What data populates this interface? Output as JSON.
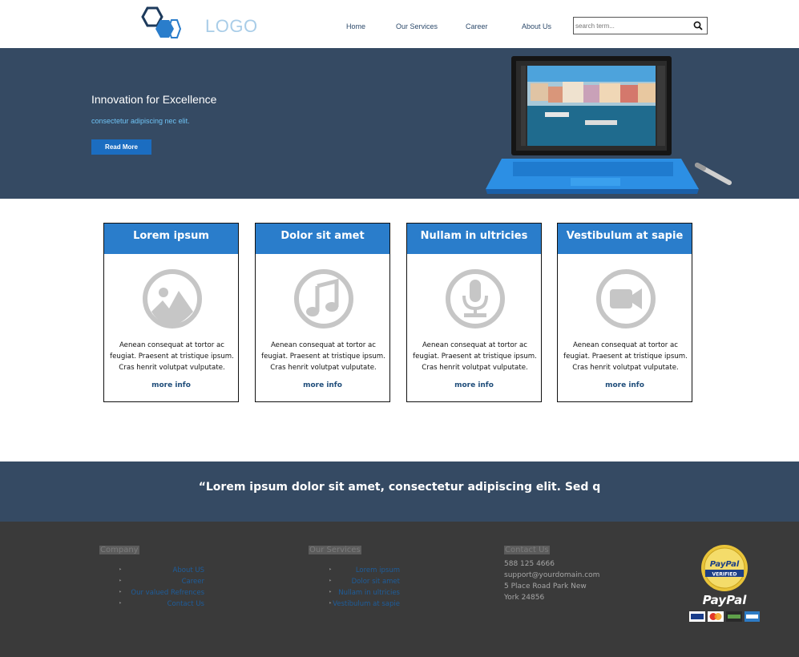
{
  "header": {
    "logo_text": "LOGO",
    "nav": [
      "Home",
      "Our Services",
      "Career",
      "About Us"
    ],
    "search_placeholder": "search term..."
  },
  "hero": {
    "title": "Innovation for Excellence",
    "subtitle": "consectetur adipiscing nec elit.",
    "button_label": "Read More"
  },
  "cards": [
    {
      "title": "Lorem ipsum",
      "icon": "image-icon",
      "text": "Aenean consequat at tortor ac feugiat. Praesent at tristique ipsum. Cras henrit volutpat vulputate.",
      "link": "more info"
    },
    {
      "title": "Dolor sit amet",
      "icon": "music-icon",
      "text": "Aenean consequat at tortor ac feugiat. Praesent at tristique ipsum. Cras henrit volutpat vulputate.",
      "link": "more info"
    },
    {
      "title": "Nullam in ultricies",
      "icon": "microphone-icon",
      "text": "Aenean consequat at tortor ac feugiat. Praesent at tristique ipsum. Cras henrit volutpat vulputate.",
      "link": "more info"
    },
    {
      "title": "Vestibulum at sapie",
      "icon": "video-camera-icon",
      "text": "Aenean consequat at tortor ac feugiat. Praesent at tristique ipsum. Cras henrit volutpat vulputate.",
      "link": "more info"
    }
  ],
  "quote": {
    "text": "“Lorem ipsum dolor sit amet, consectetur adipiscing elit. Sed q"
  },
  "footer": {
    "company_heading": "Company",
    "company_links": [
      "About US",
      "Career",
      "Our valued Refrences",
      "Contact Us"
    ],
    "services_heading": "Our Services",
    "services_links": [
      "Lorem ipsum",
      "Dolor sit amet",
      "Nullam in ultricies",
      "Vestibulum at sapie"
    ],
    "contact_heading": "Contact Us",
    "phone": "588 125 4666",
    "email": "support@yourdomain.com",
    "address_line1": "5 Place Road Park New",
    "address_line2": "York 24856",
    "paypal_seal_line1": "PayPal",
    "paypal_seal_line2": "VERIFIED",
    "paypal_text": "PayPal"
  },
  "colors": {
    "hero_bg": "#354a63",
    "accent_blue": "#2a7dcb",
    "button_blue": "#1b6dc1",
    "footer_bg": "#3a3a3a"
  }
}
